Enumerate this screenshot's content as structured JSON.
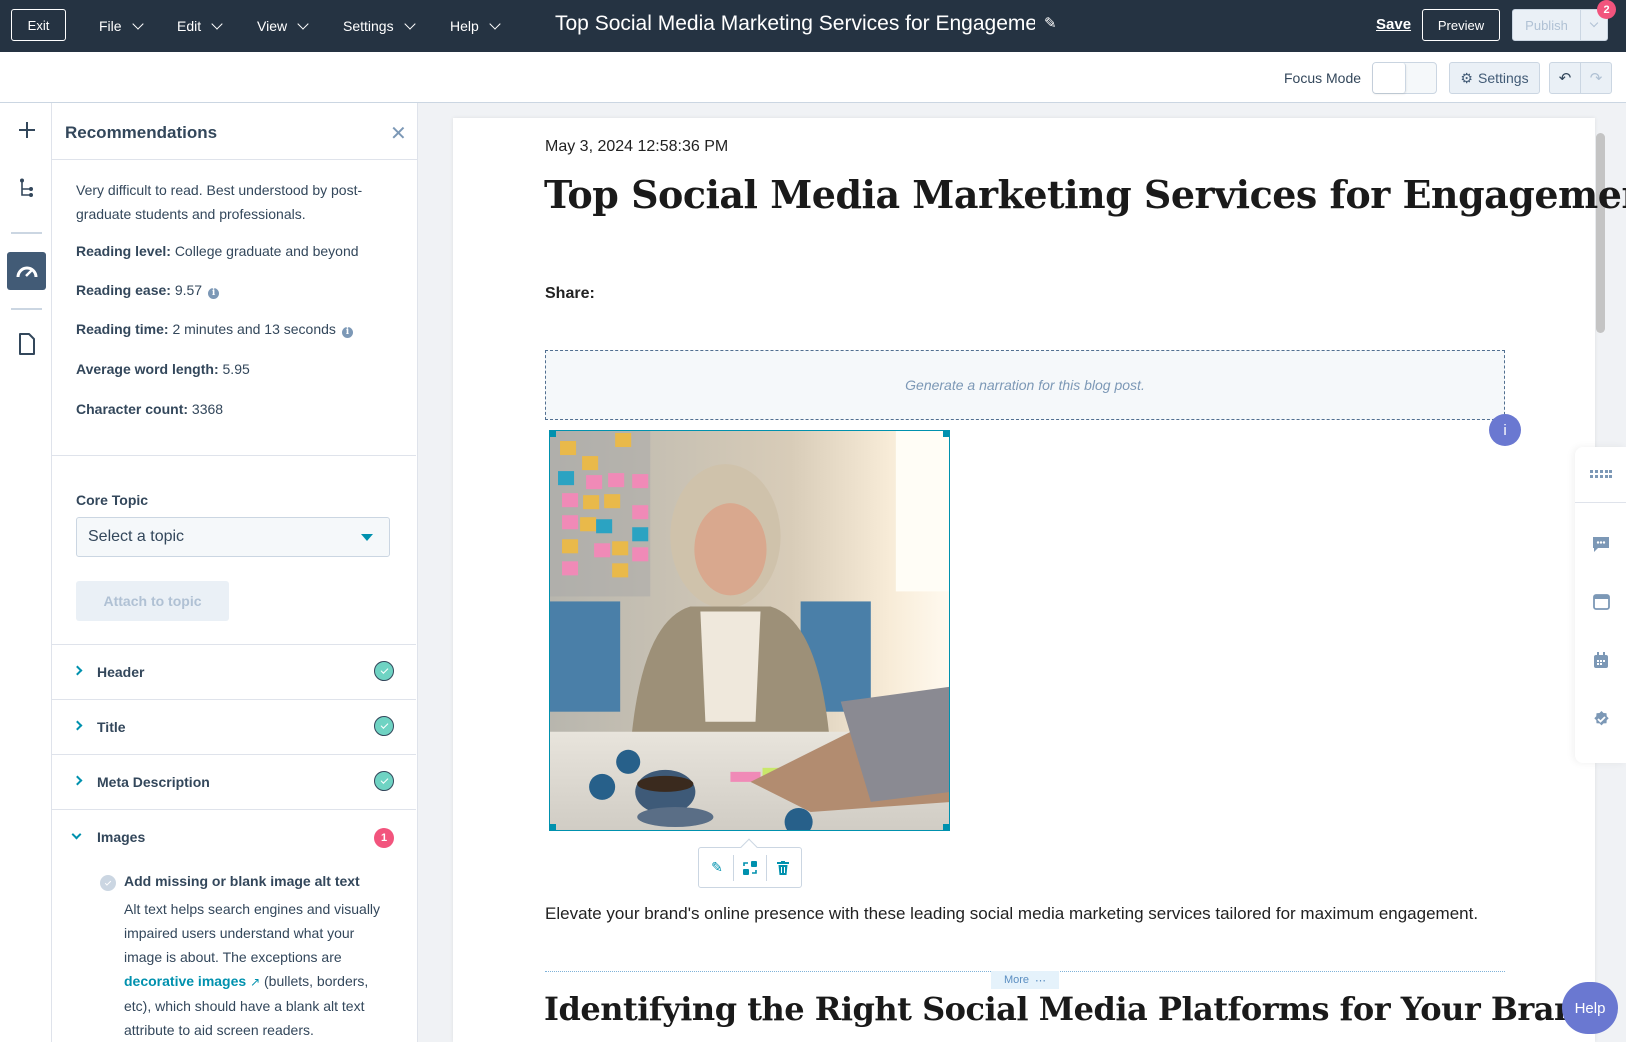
{
  "topbar": {
    "exit_label": "Exit",
    "menus": [
      {
        "label": "File"
      },
      {
        "label": "Edit"
      },
      {
        "label": "View"
      },
      {
        "label": "Settings"
      },
      {
        "label": "Help"
      }
    ],
    "document_title": "Top Social Media Marketing Services for Engagement",
    "save_label": "Save",
    "preview_label": "Preview",
    "publish_label": "Publish",
    "publish_badge": "2"
  },
  "subbar": {
    "focus_mode_label": "Focus Mode",
    "focus_mode_on": false,
    "settings_label": "Settings"
  },
  "rail": {
    "items": [
      {
        "icon": "plus-icon"
      },
      {
        "icon": "tree-icon"
      },
      {
        "icon": "gauge-icon",
        "active": true
      },
      {
        "icon": "document-icon"
      }
    ]
  },
  "panel": {
    "title": "Recommendations",
    "summary": "Very difficult to read. Best understood by post-graduate students and professionals.",
    "stats": [
      {
        "label": "Reading level:",
        "value": "College graduate and beyond",
        "info": false
      },
      {
        "label": "Reading ease:",
        "value": "9.57",
        "info": true
      },
      {
        "label": "Reading time:",
        "value": "2 minutes and 13 seconds",
        "info": true
      },
      {
        "label": "Average word length:",
        "value": "5.95",
        "info": false
      },
      {
        "label": "Character count:",
        "value": "3368",
        "info": false
      }
    ],
    "core_topic": {
      "label": "Core Topic",
      "placeholder": "Select a topic",
      "attach_label": "Attach to topic"
    },
    "sections": [
      {
        "label": "Header",
        "status": "ok"
      },
      {
        "label": "Title",
        "status": "ok"
      },
      {
        "label": "Meta Description",
        "status": "ok"
      },
      {
        "label": "Images",
        "status": "issues",
        "count": "1",
        "expanded": true
      }
    ],
    "image_recommendation": {
      "title": "Add missing or blank image alt text",
      "desc_before": "Alt text helps search engines and visually impaired users understand what your image is about. The exceptions are ",
      "link_text": "decorative images",
      "desc_after": " (bullets, borders, etc), which should have a blank alt text attribute to aid screen readers."
    }
  },
  "page": {
    "date": "May 3, 2024 12:58:36 PM",
    "title": "Top Social Media Marketing Services for Engagement",
    "share_label": "Share:",
    "narration_placeholder": "Generate a narration for this blog post.",
    "info_label": "i",
    "image_alt": "",
    "intro": "Elevate your brand's online presence with these leading social media marketing services tailored for maximum engagement.",
    "more_label": "More",
    "h2": "Identifying the Right Social Media Platforms for Your Brand"
  },
  "help_label": "Help",
  "colors": {
    "topbar": "#253342",
    "accent": "#0091ae",
    "badge": "#f2547d",
    "ok": "#6fd3c3",
    "help": "#6a78d1"
  }
}
